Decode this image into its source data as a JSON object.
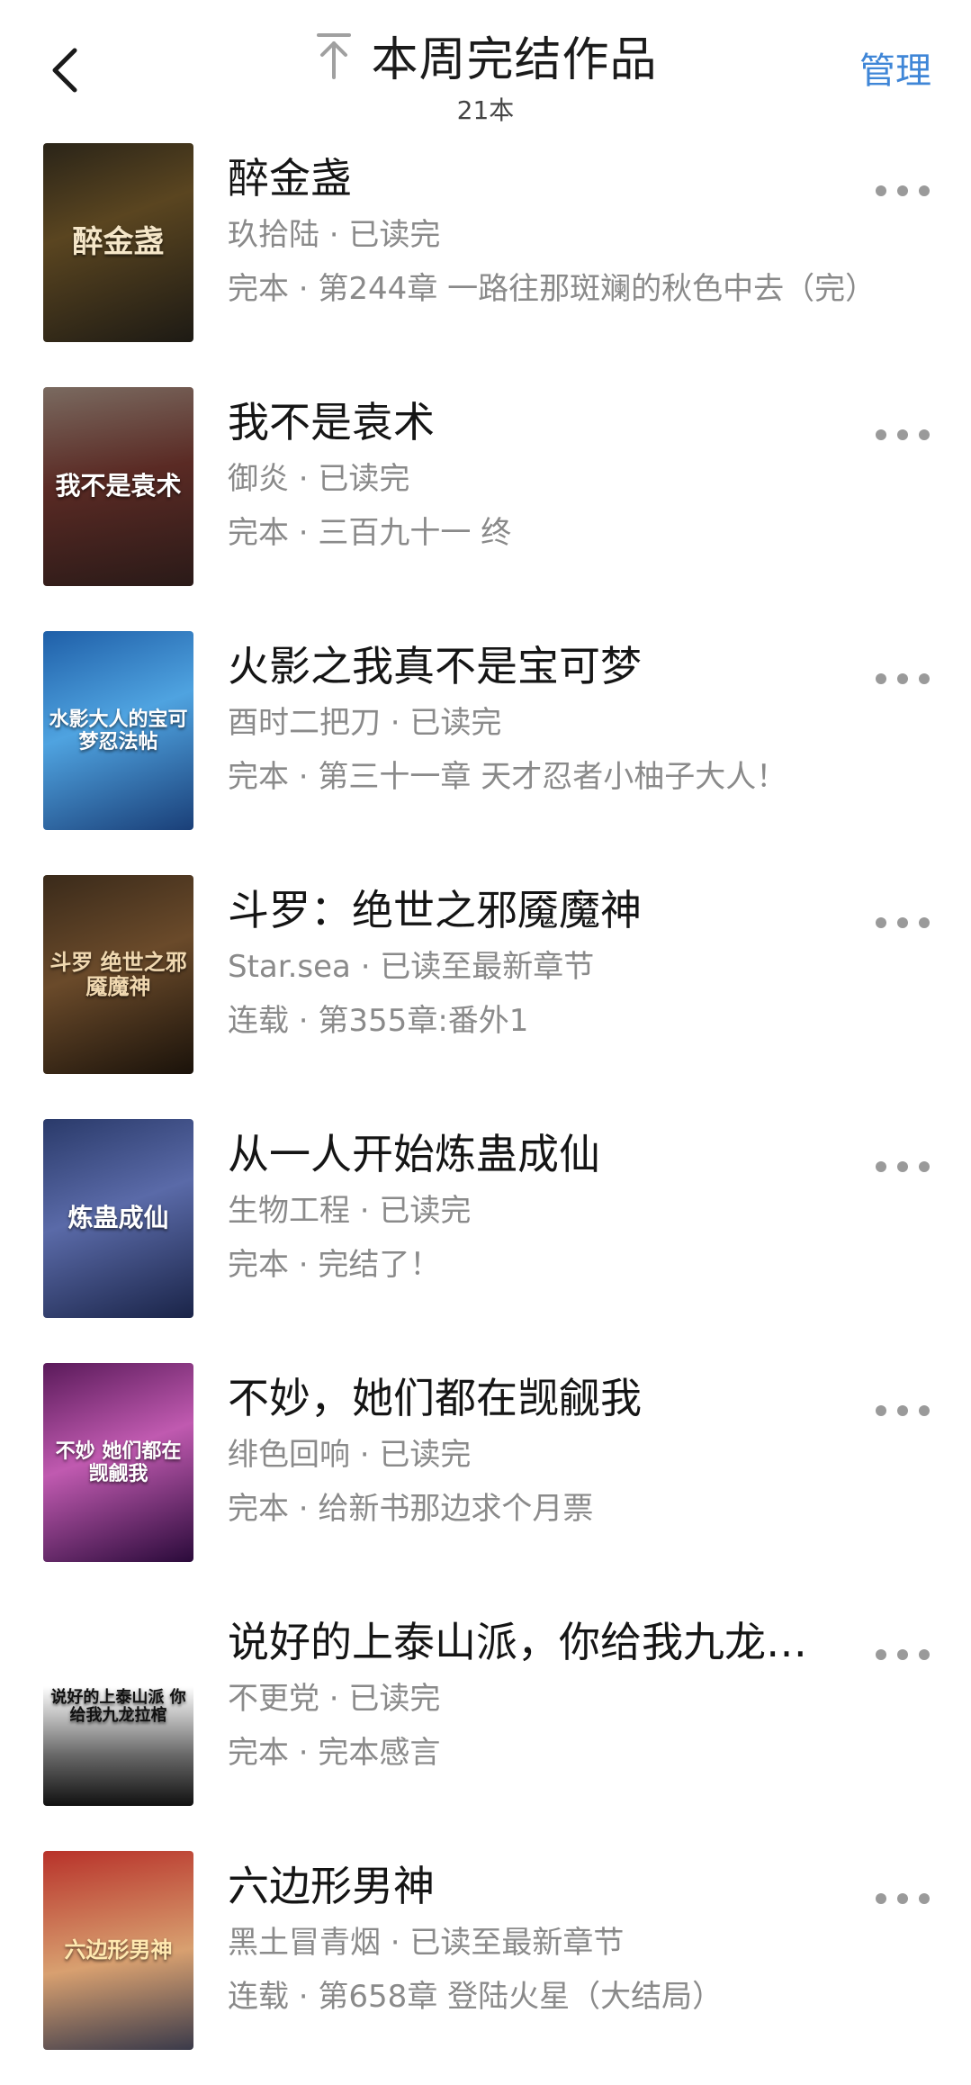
{
  "header": {
    "title": "本周完结作品",
    "count": "21本",
    "manage": "管理"
  },
  "icons": {
    "back": "back-chevron-icon",
    "scroll_top": "arrow-up-to-top-icon",
    "more": "more-dots-icon"
  },
  "colors": {
    "accent": "#3f86d7",
    "secondary_text": "#8a8a8a"
  },
  "books": [
    {
      "title": "醉金盏",
      "author": "玖拾陆",
      "status": "已读完",
      "state": "完本",
      "chapter": "第244章 一路往那斑斓的秋色中去（完）",
      "cover_text": "醉金盏"
    },
    {
      "title": "我不是袁术",
      "author": "御炎",
      "status": "已读完",
      "state": "完本",
      "chapter": "三百九十一 终",
      "cover_text": "我不是袁术"
    },
    {
      "title": "火影之我真不是宝可梦",
      "author": "酉时二把刀",
      "status": "已读完",
      "state": "完本",
      "chapter": "第三十一章 天才忍者小柚子大人！",
      "cover_text": "水影大人的宝可梦忍法帖"
    },
    {
      "title": "斗罗：绝世之邪魇魔神",
      "author": "Star.sea",
      "status": "已读至最新章节",
      "state": "连载",
      "chapter": "第355章:番外1",
      "cover_text": "斗罗 绝世之邪魇魔神"
    },
    {
      "title": "从一人开始炼蛊成仙",
      "author": "生物工程",
      "status": "已读完",
      "state": "完本",
      "chapter": "完结了！",
      "cover_text": "炼蛊成仙"
    },
    {
      "title": "不妙，她们都在觊觎我",
      "author": "绯色回响",
      "status": "已读完",
      "state": "完本",
      "chapter": "给新书那边求个月票",
      "cover_text": "不妙 她们都在觊觎我"
    },
    {
      "title": "说好的上泰山派，你给我九龙拉棺",
      "author": "不更党",
      "status": "已读完",
      "state": "完本",
      "chapter": "完本感言",
      "cover_text": "说好的上泰山派 你给我九龙拉棺"
    },
    {
      "title": "六边形男神",
      "author": "黑土冒青烟",
      "status": "已读至最新章节",
      "state": "连载",
      "chapter": "第658章 登陆火星（大结局）",
      "cover_text": "六边形男神"
    }
  ]
}
